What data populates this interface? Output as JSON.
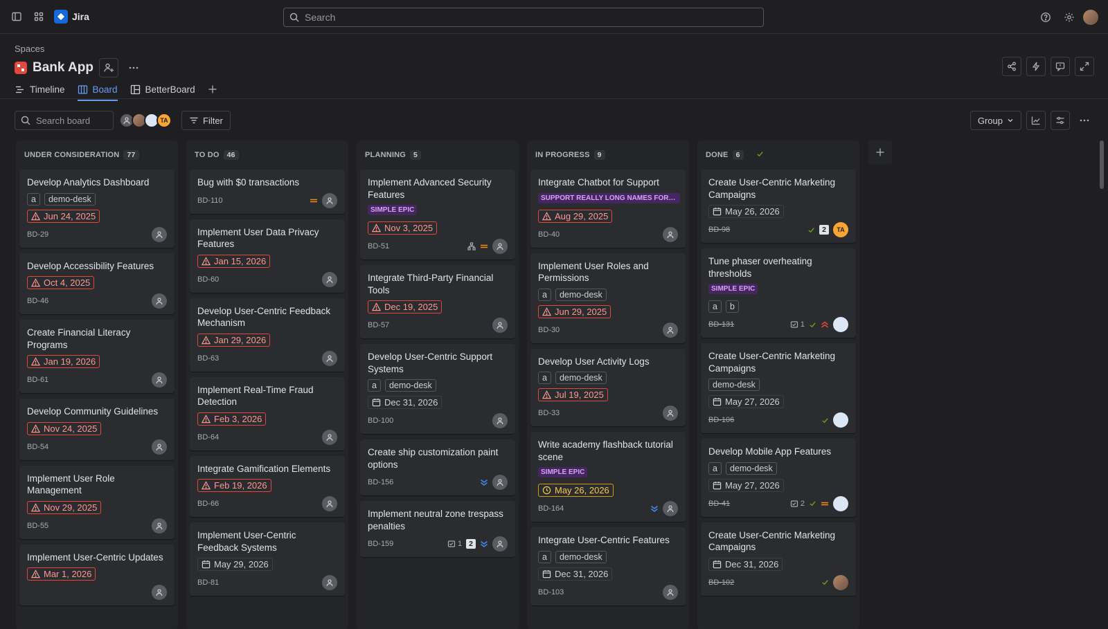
{
  "app": {
    "name": "Jira",
    "search_placeholder": "Search"
  },
  "breadcrumb": "Spaces",
  "project": {
    "title": "Bank App"
  },
  "tabs": [
    {
      "label": "Timeline",
      "active": false
    },
    {
      "label": "Board",
      "active": true
    },
    {
      "label": "BetterBoard",
      "active": false
    }
  ],
  "toolbar": {
    "search_placeholder": "Search board",
    "filter_label": "Filter",
    "group_label": "Group",
    "avatar_initials": "TA"
  },
  "columns": [
    {
      "name": "UNDER CONSIDERATION",
      "count": "77",
      "cards": [
        {
          "title": "Develop Analytics Dashboard",
          "tags": [
            "a",
            "demo-desk"
          ],
          "date": "Jun 24, 2025",
          "date_style": "over",
          "key": "BD-29"
        },
        {
          "title": "Develop Accessibility Features",
          "date": "Oct 4, 2025",
          "date_style": "over",
          "key": "BD-46"
        },
        {
          "title": "Create Financial Literacy Programs",
          "date": "Jan 19, 2026",
          "date_style": "over",
          "key": "BD-61"
        },
        {
          "title": "Develop Community Guidelines",
          "date": "Nov 24, 2025",
          "date_style": "over",
          "key": "BD-54"
        },
        {
          "title": "Implement User Role Management",
          "date": "Nov 29, 2025",
          "date_style": "over",
          "key": "BD-55"
        },
        {
          "title": "Implement User-Centric Updates",
          "date": "Mar 1, 2026",
          "date_style": "over",
          "key": ""
        }
      ]
    },
    {
      "name": "TO DO",
      "count": "46",
      "cards": [
        {
          "title": "Bug with $0 transactions",
          "key": "BD-110",
          "priority": "medium"
        },
        {
          "title": "Implement User Data Privacy Features",
          "date": "Jan 15, 2026",
          "date_style": "over",
          "key": "BD-60"
        },
        {
          "title": "Develop User-Centric Feedback Mechanism",
          "date": "Jan 29, 2026",
          "date_style": "over",
          "key": "BD-63"
        },
        {
          "title": "Implement Real-Time Fraud Detection",
          "date": "Feb 3, 2026",
          "date_style": "over",
          "key": "BD-64"
        },
        {
          "title": "Integrate Gamification Elements",
          "date": "Feb 19, 2026",
          "date_style": "over",
          "key": "BD-66"
        },
        {
          "title": "Implement User-Centric Feedback Systems",
          "date": "May 29, 2026",
          "date_style": "norm",
          "key": "BD-81"
        }
      ]
    },
    {
      "name": "PLANNING",
      "count": "5",
      "cards": [
        {
          "title": "Implement Advanced Security Features",
          "epic": "SIMPLE EPIC",
          "date": "Nov 3, 2025",
          "date_style": "over",
          "key": "BD-51",
          "priority": "medium",
          "hierarchy": true
        },
        {
          "title": "Integrate Third-Party Financial Tools",
          "date": "Dec 19, 2025",
          "date_style": "over",
          "key": "BD-57"
        },
        {
          "title": "Develop User-Centric Support Systems",
          "tags": [
            "a",
            "demo-desk"
          ],
          "date": "Dec 31, 2026",
          "date_style": "norm",
          "key": "BD-100"
        },
        {
          "title": "Create ship customization paint options",
          "key": "BD-156",
          "priority": "lowest"
        },
        {
          "title": "Implement neutral zone trespass penalties",
          "key": "BD-159",
          "priority": "lowest",
          "subtasks": "1",
          "badge": "2"
        }
      ]
    },
    {
      "name": "IN PROGRESS",
      "count": "9",
      "cards": [
        {
          "title": "Integrate Chatbot for Support",
          "epic": "SUPPORT REALLY LONG NAMES FOR E...",
          "date": "Aug 29, 2025",
          "date_style": "over",
          "key": "BD-40"
        },
        {
          "title": "Implement User Roles and Permissions",
          "tags": [
            "a",
            "demo-desk"
          ],
          "date": "Jun 29, 2025",
          "date_style": "over",
          "key": "BD-30"
        },
        {
          "title": "Develop User Activity Logs",
          "tags": [
            "a",
            "demo-desk"
          ],
          "date": "Jul 19, 2025",
          "date_style": "over",
          "key": "BD-33"
        },
        {
          "title": "Write academy flashback tutorial scene",
          "epic": "SIMPLE EPIC",
          "date": "May 26, 2026",
          "date_style": "warn",
          "key": "BD-164",
          "priority": "lowest"
        },
        {
          "title": "Integrate User-Centric Features",
          "tags": [
            "a",
            "demo-desk"
          ],
          "date": "Dec 31, 2026",
          "date_style": "norm",
          "key": "BD-103"
        }
      ]
    },
    {
      "name": "DONE",
      "count": "6",
      "cards": [
        {
          "title": "Create User-Centric Marketing Campaigns",
          "date": "May 26, 2026",
          "date_style": "norm",
          "key": "BD-98",
          "done": true,
          "badge": "2",
          "avatar": "ta"
        },
        {
          "title": "Tune phaser overheating thresholds",
          "epic": "SIMPLE EPIC",
          "tags": [
            "a",
            "b"
          ],
          "key": "BD-131",
          "done": true,
          "subtasks": "1",
          "priority": "high",
          "avatar": "blue"
        },
        {
          "title": "Create User-Centric Marketing Campaigns",
          "tags": [
            "demo-desk"
          ],
          "date": "May 27, 2026",
          "date_style": "norm",
          "key": "BD-106",
          "done": true,
          "avatar": "blue"
        },
        {
          "title": "Develop Mobile App Features",
          "tags": [
            "a",
            "demo-desk"
          ],
          "date": "May 27, 2026",
          "date_style": "norm",
          "key": "BD-41",
          "done": true,
          "subtasks": "2",
          "priority": "medium",
          "avatar": "blue"
        },
        {
          "title": "Create User-Centric Marketing Campaigns",
          "date": "Dec 31, 2026",
          "date_style": "norm",
          "key": "BD-102",
          "done": true,
          "avatar": "photo"
        }
      ]
    }
  ]
}
